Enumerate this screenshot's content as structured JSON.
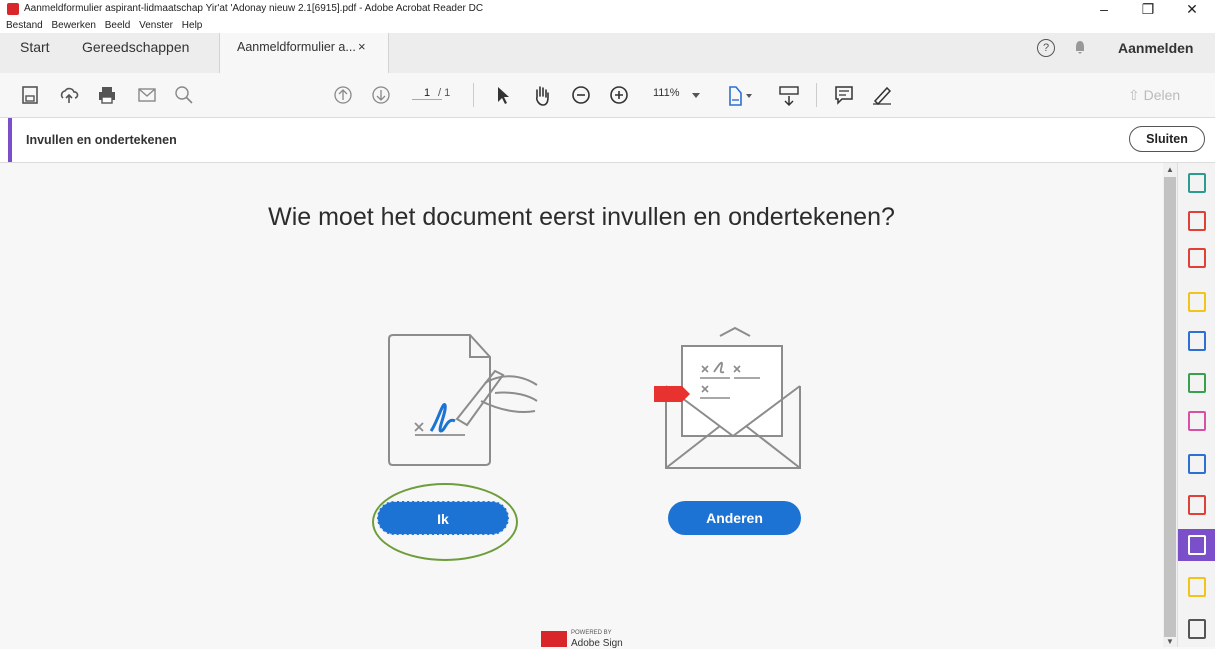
{
  "window": {
    "title": "Aanmeldformulier aspirant-lidmaatschap Yir'at 'Adonay nieuw 2.1[6915].pdf - Adobe Acrobat Reader DC",
    "minimize": "–",
    "restore": "❐",
    "close": "✕"
  },
  "menu": [
    "Bestand",
    "Bewerken",
    "Beeld",
    "Venster",
    "Help"
  ],
  "tabs": {
    "start": "Start",
    "tools": "Gereedschappen",
    "document": "Aanmeldformulier a...",
    "close": "×",
    "help": "?",
    "signin": "Aanmelden"
  },
  "toolbar": {
    "page_current": "1",
    "page_total": "/ 1",
    "zoom": "111%",
    "share": "Delen"
  },
  "panel": {
    "label": "Invullen en ondertekenen",
    "close_button": "Sluiten"
  },
  "main": {
    "question": "Wie moet het document eerst invullen en ondertekenen?",
    "me_button": "Ik",
    "others_button": "Anderen"
  },
  "footer": {
    "powered": "POWERED BY",
    "brand": "Adobe Sign"
  },
  "right_tools": [
    {
      "icon": "create-pdf-icon",
      "color": "#2a9d8f"
    },
    {
      "icon": "add-pdf-icon",
      "color": "#e0403a"
    },
    {
      "icon": "organize-pages-icon",
      "color": "#e0403a"
    },
    {
      "icon": "comment-icon",
      "color": "#f2c318"
    },
    {
      "icon": "export-pdf-icon",
      "color": "#2d6fd2"
    },
    {
      "icon": "compare-icon",
      "color": "#38a04f"
    },
    {
      "icon": "fill-sign-icon",
      "color": "#d94fa6"
    },
    {
      "icon": "protect-icon",
      "color": "#2d6fd2"
    },
    {
      "icon": "pdf-icon",
      "color": "#e0403a"
    },
    {
      "icon": "fill-sign-active-icon",
      "color": "#ffffff"
    },
    {
      "icon": "send-for-review-icon",
      "color": "#f2c318"
    },
    {
      "icon": "more-tools-icon",
      "color": "#555555"
    }
  ],
  "colors": {
    "accent": "#7b4fc9",
    "primary_button": "#1d73d3",
    "highlight_ring": "#6e9d3b"
  }
}
